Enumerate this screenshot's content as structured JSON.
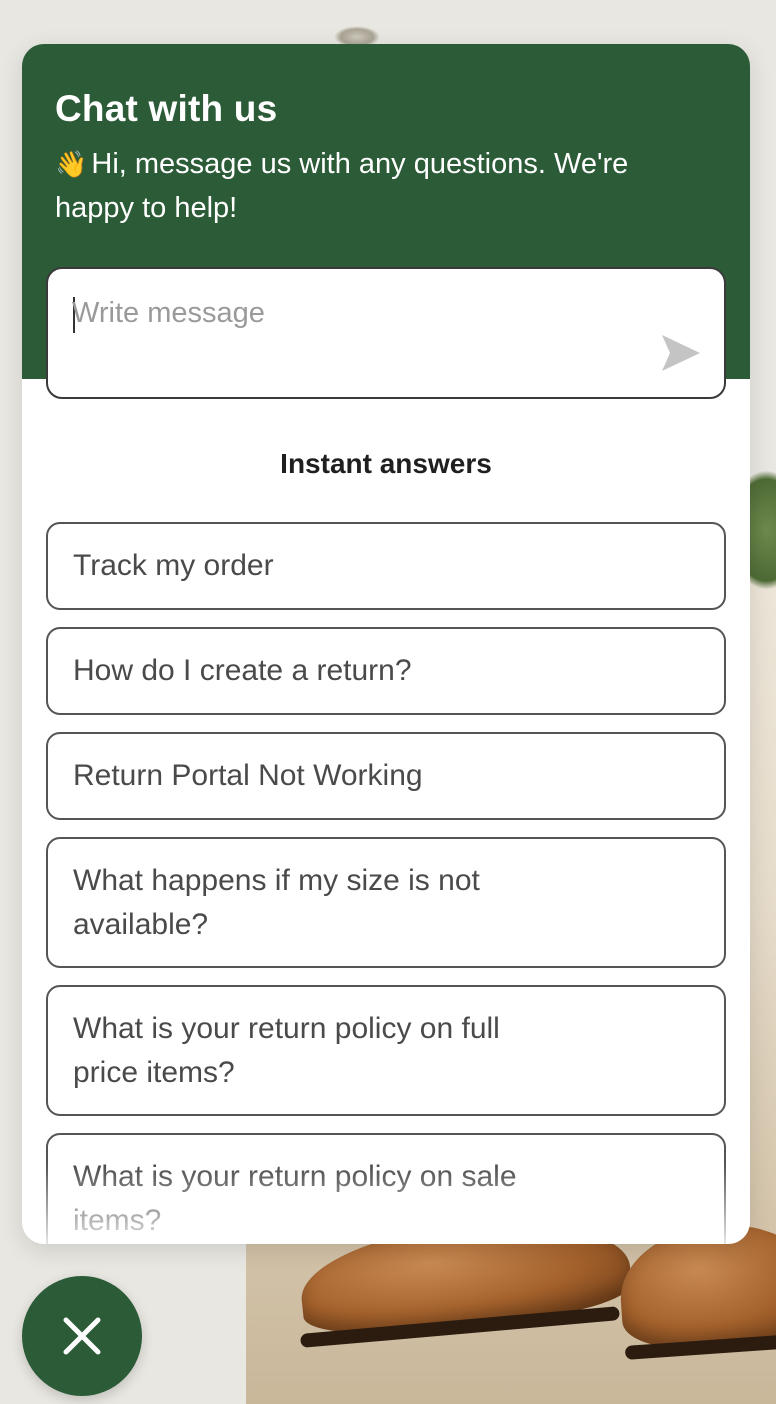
{
  "chat": {
    "title": "Chat with us",
    "greeting_emoji": "👋",
    "subtitle": "Hi, message us with any questions. We're happy to help!"
  },
  "compose": {
    "placeholder": "Write message",
    "value": ""
  },
  "instant_answers": {
    "title": "Instant answers",
    "items": [
      "Track my order",
      "How do I create a return?",
      "Return Portal Not Working",
      "What happens if my size is not available?",
      "What is your return policy on full price items?",
      "What is your return policy on sale items?"
    ]
  },
  "icons": {
    "send": "send-icon",
    "close": "close-icon",
    "wave": "waving-hand-icon"
  },
  "colors": {
    "brand_green": "#2c5b37",
    "panel_bg": "#ffffff",
    "text_muted": "#4a4a4a"
  }
}
